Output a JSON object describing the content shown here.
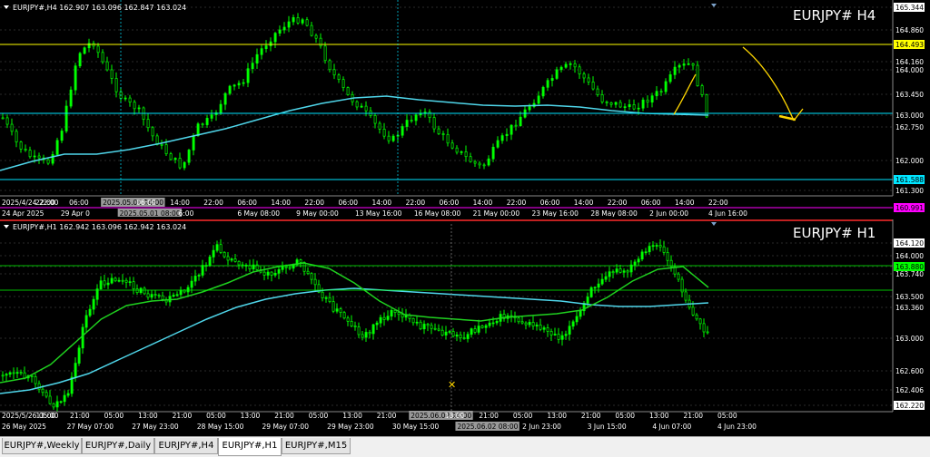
{
  "top": {
    "header": "EURJPY#,H4  162.907 163.096 162.847 163.024",
    "label": "EURJPY# H4",
    "prices": [
      "165.344",
      "164.860",
      "164.493",
      "164.160",
      "164.000",
      "163.450",
      "163.000",
      "162.750",
      "162.000",
      "161.588",
      "161.300",
      "160.991"
    ],
    "price_colors": [
      "#ffffff",
      "#ffffff",
      "#ffff00",
      "#ffffff",
      "#ffffff",
      "#ffffff",
      "#ffffff",
      "#ffffff",
      "#ffffff",
      "#00e5ff",
      "#ffffff",
      "#ff00ff"
    ],
    "time_row1": [
      "2025/4/24 22:00",
      "22:00",
      "06:00",
      "2025.05.01 14:00",
      "06:00",
      "14:00",
      "22:00",
      "06:00",
      "14:00",
      "22:00",
      "06:00",
      "14:00",
      "22:00",
      "06:00",
      "14:00",
      "22:00",
      "06:00",
      "14:00",
      "22:00",
      "06:00",
      "14:00",
      "22:00"
    ],
    "time_row2": [
      "24 Apr 2025",
      "29 Apr 0",
      "2025.05.01 08:00",
      "6:00",
      "6 May 08:00",
      "9 May 00:00",
      "13 May 16:00",
      "16 May 08:00",
      "21 May 00:00",
      "23 May 16:00",
      "28 May 08:00",
      "2 Jun 00:00",
      "4 Jun 16:00"
    ]
  },
  "bottom": {
    "header": "EURJPY#,H1  162.942 163.096 162.942 163.024",
    "label": "EURJPY# H1",
    "prices": [
      "164.120",
      "164.000",
      "163.880",
      "163.740",
      "163.500",
      "163.360",
      "163.000",
      "162.600",
      "162.406",
      "162.220"
    ],
    "price_colors": [
      "#ffffff",
      "#ffffff",
      "#00ff00",
      "#ffffff",
      "#ffffff",
      "#ffffff",
      "#ffffff",
      "#ffffff",
      "#ffffff",
      "#ffffff"
    ],
    "time_row1": [
      "2025/5/26 05:00",
      "13:00",
      "21:00",
      "05:00",
      "13:00",
      "21:00",
      "05:00",
      "13:00",
      "21:00",
      "05:00",
      "13:00",
      "21:00",
      "2025.06.02 14:00",
      "13:00",
      "21:00",
      "05:00",
      "13:00",
      "21:00",
      "05:00",
      "13:00",
      "21:00",
      "05:00"
    ],
    "time_row2": [
      "26 May 2025",
      "27 May 07:00",
      "27 May 23:00",
      "28 May 15:00",
      "29 May 07:00",
      "29 May 23:00",
      "30 May 15:00",
      "2025.06.02 08:00",
      "2 Jun 23:00",
      "3 Jun 15:00",
      "4 Jun 07:00",
      "4 Jun 23:00"
    ]
  },
  "tabs": [
    {
      "label": "EURJPY#,Weekly",
      "active": false
    },
    {
      "label": "EURJPY#,Daily",
      "active": false
    },
    {
      "label": "EURJPY#,H4",
      "active": false
    },
    {
      "label": "EURJPY#,H1",
      "active": true
    },
    {
      "label": "EURJPY#,M15",
      "active": false
    }
  ],
  "colors": {
    "bull": "#00ff00",
    "ma_cyan": "#4fd6ea",
    "ma_green": "#1fd11f",
    "annotation": "#ffd700",
    "axis_text": "#ffffff"
  }
}
